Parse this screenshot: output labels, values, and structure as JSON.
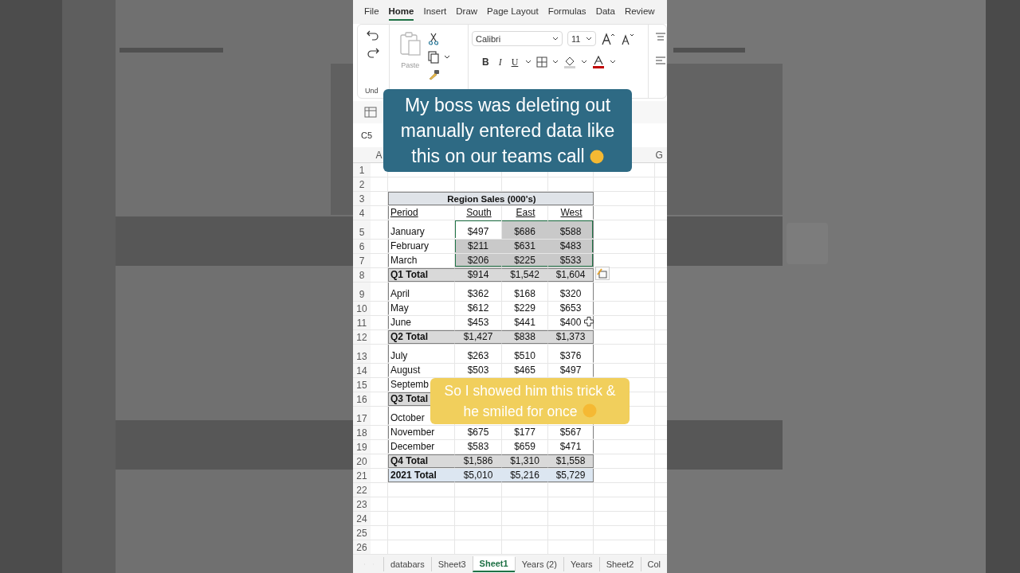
{
  "backdrop": {
    "kind": "picture"
  },
  "ribbon_tabs": [
    {
      "label": "File",
      "selected": false
    },
    {
      "label": "Home",
      "selected": true
    },
    {
      "label": "Insert",
      "selected": false
    },
    {
      "label": "Draw",
      "selected": false
    },
    {
      "label": "Page Layout",
      "selected": false
    },
    {
      "label": "Formulas",
      "selected": false
    },
    {
      "label": "Data",
      "selected": false
    },
    {
      "label": "Review",
      "selected": false
    }
  ],
  "ribbon": {
    "paste_label": "Paste",
    "paste_disabled": true,
    "font": "Calibri",
    "font_size": "11",
    "bold": "B",
    "italic": "I",
    "underline": "U",
    "group_label": "Und"
  },
  "name_box": "C5",
  "column_headers": [
    "A",
    "G"
  ],
  "row_numbers": [
    "1",
    "2",
    "3",
    "4",
    "5",
    "6",
    "7",
    "8",
    "9",
    "10",
    "11",
    "12",
    "13",
    "14",
    "15",
    "16",
    "17",
    "18",
    "19",
    "20",
    "21",
    "22",
    "23",
    "24",
    "25",
    "26"
  ],
  "table": {
    "title": "Region Sales (000's)",
    "columns": [
      "Period",
      "South",
      "East",
      "West"
    ],
    "rows": [
      {
        "kind": "month",
        "label": "January",
        "values": [
          "$497",
          "$686",
          "$588"
        ],
        "selected": [
          false,
          true,
          true
        ]
      },
      {
        "kind": "month",
        "label": "February",
        "values": [
          "$211",
          "$631",
          "$483"
        ],
        "selected": [
          true,
          true,
          true
        ]
      },
      {
        "kind": "month",
        "label": "March",
        "values": [
          "$206",
          "$225",
          "$533"
        ],
        "selected": [
          true,
          true,
          true
        ]
      },
      {
        "kind": "total",
        "label": "Q1 Total",
        "values": [
          "$914",
          "$1,542",
          "$1,604"
        ],
        "selected": [
          false,
          false,
          false
        ]
      },
      {
        "kind": "month",
        "label": "April",
        "values": [
          "$362",
          "$168",
          "$320"
        ],
        "selected": [
          false,
          false,
          false
        ]
      },
      {
        "kind": "month",
        "label": "May",
        "values": [
          "$612",
          "$229",
          "$653"
        ],
        "selected": [
          false,
          false,
          false
        ]
      },
      {
        "kind": "month",
        "label": "June",
        "values": [
          "$453",
          "$441",
          "$400"
        ],
        "selected": [
          false,
          false,
          false
        ]
      },
      {
        "kind": "total",
        "label": "Q2 Total",
        "values": [
          "$1,427",
          "$838",
          "$1,373"
        ],
        "selected": [
          false,
          false,
          false
        ]
      },
      {
        "kind": "month",
        "label": "July",
        "values": [
          "$263",
          "$510",
          "$376"
        ],
        "selected": [
          false,
          false,
          false
        ]
      },
      {
        "kind": "month",
        "label": "August",
        "values": [
          "$503",
          "$465",
          "$497"
        ],
        "selected": [
          false,
          false,
          false
        ]
      },
      {
        "kind": "month",
        "label": "Septemb"
      },
      {
        "kind": "total",
        "label": "Q3 Total"
      },
      {
        "kind": "month",
        "label": "October"
      },
      {
        "kind": "month",
        "label": "November",
        "values": [
          "$675",
          "$177",
          "$567"
        ],
        "selected": [
          false,
          false,
          false
        ]
      },
      {
        "kind": "month",
        "label": "December",
        "values": [
          "$583",
          "$659",
          "$471"
        ],
        "selected": [
          false,
          false,
          false
        ]
      },
      {
        "kind": "total",
        "label": "Q4 Total",
        "values": [
          "$1,586",
          "$1,310",
          "$1,558"
        ],
        "selected": [
          false,
          false,
          false
        ]
      },
      {
        "kind": "grand",
        "label": "2021 Total",
        "values": [
          "$5,010",
          "$5,216",
          "$5,729"
        ],
        "selected": [
          false,
          false,
          false
        ]
      }
    ]
  },
  "sheet_tabs": [
    {
      "label": "databars",
      "selected": false
    },
    {
      "label": "Sheet3",
      "selected": false
    },
    {
      "label": "Sheet1",
      "selected": true
    },
    {
      "label": "Years (2)",
      "selected": false
    },
    {
      "label": "Years",
      "selected": false
    },
    {
      "label": "Sheet2",
      "selected": false
    },
    {
      "label": "Col",
      "selected": false
    }
  ],
  "captions": [
    {
      "kind": "teal",
      "text": "My boss was deleting out manually entered data like this on our teams call"
    },
    {
      "kind": "yellow",
      "text": "So I showed him this trick & he smiled for once"
    }
  ]
}
